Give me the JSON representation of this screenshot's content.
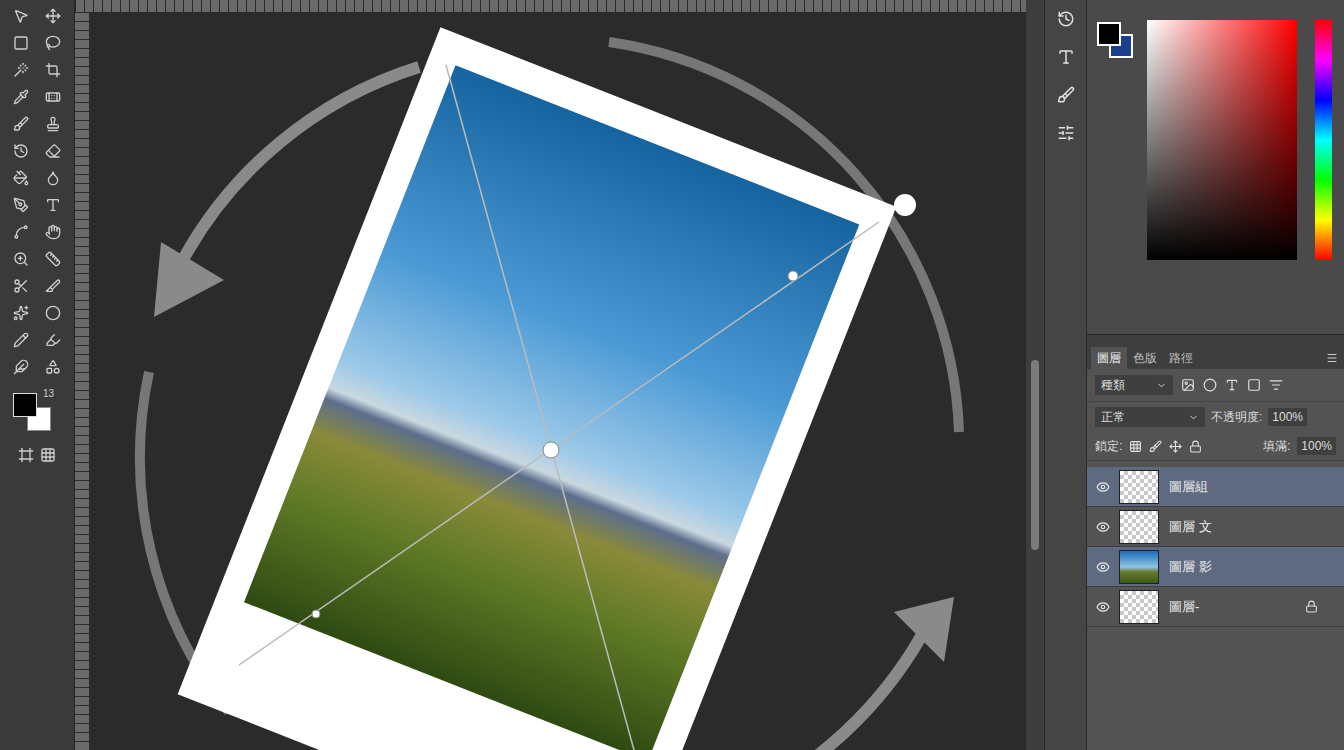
{
  "toolbar": {
    "swatch_label": "13",
    "foreground": "#000000",
    "background": "#ffffff"
  },
  "color_panel": {
    "foreground": "#000000",
    "background": "#1b3f8f",
    "hue_color": "#ff0000"
  },
  "layers_panel": {
    "tabs": [
      {
        "label": "圖層",
        "selected": true
      },
      {
        "label": "色版",
        "selected": false
      },
      {
        "label": "路徑",
        "selected": false
      }
    ],
    "filter": "種類",
    "blend_mode": "正常",
    "opacity_label": "不透明度:",
    "opacity": "100%",
    "lock_label": "鎖定:",
    "fill_label": "填滿:",
    "fill": "100%",
    "layers": [
      {
        "name": "圖層組",
        "visible": true,
        "selected": true,
        "kind": "transparent",
        "locked": false
      },
      {
        "name": "圖層 文",
        "visible": true,
        "selected": false,
        "kind": "transparent",
        "locked": false
      },
      {
        "name": "圖層 影",
        "visible": true,
        "selected": true,
        "kind": "photo",
        "locked": false
      },
      {
        "name": "圖層-",
        "visible": true,
        "selected": false,
        "kind": "transparent",
        "locked": true
      }
    ]
  }
}
